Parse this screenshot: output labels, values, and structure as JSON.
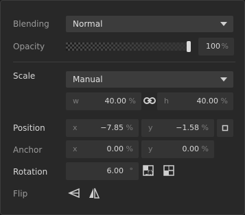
{
  "blending": {
    "label": "Blending",
    "value": "Normal"
  },
  "opacity": {
    "label": "Opacity",
    "value": "100",
    "unit": "%",
    "level": 1.0
  },
  "scale": {
    "label": "Scale",
    "mode": "Manual",
    "w_prefix": "w",
    "w_value": "40.00",
    "w_unit": "%",
    "h_prefix": "h",
    "h_value": "40.00",
    "h_unit": "%"
  },
  "position": {
    "label": "Position",
    "x_prefix": "x",
    "x_value": "−7.85",
    "x_unit": "%",
    "y_prefix": "y",
    "y_value": "−1.58",
    "y_unit": "%"
  },
  "anchor": {
    "label": "Anchor",
    "x_prefix": "x",
    "x_value": "0.00",
    "x_unit": "%",
    "y_prefix": "y",
    "y_value": "0.00",
    "y_unit": "%"
  },
  "rotation": {
    "label": "Rotation",
    "value": "6.00",
    "unit": "°"
  },
  "flip": {
    "label": "Flip"
  },
  "icons": {
    "link": "link-icon",
    "anchor_preset": "anchor-preset-icon",
    "rotate_cw": "rotate-clockwise-icon",
    "rotate_ccw": "rotate-counterclockwise-icon",
    "flip_h": "flip-horizontal-icon",
    "flip_v": "flip-vertical-icon"
  },
  "colors": {
    "panel": "#282828",
    "field": "#343434",
    "select": "#3c3c3c",
    "text": "#d2d2d2",
    "muted": "#9b9b9b"
  }
}
